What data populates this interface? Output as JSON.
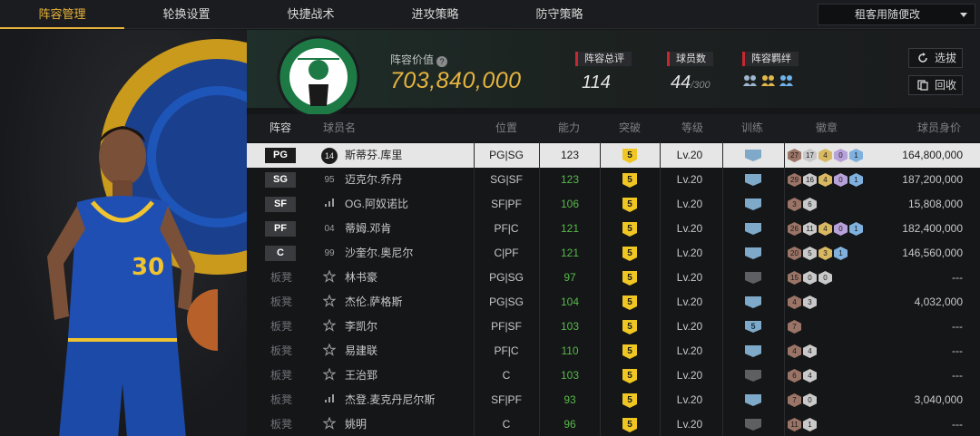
{
  "nav": {
    "tabs": [
      "阵容管理",
      "轮换设置",
      "快捷战术",
      "进攻策略",
      "防守策略"
    ],
    "active_index": 0,
    "dropdown_label": "租客用随便改"
  },
  "header": {
    "value_label": "阵容价值",
    "value": "703,840,000",
    "stats": [
      {
        "label": "阵容总评",
        "value": "114",
        "suffix": ""
      },
      {
        "label": "球员数",
        "value": "44",
        "suffix": "/300"
      },
      {
        "label": "阵容羁绊",
        "value": "",
        "suffix": ""
      }
    ],
    "buttons": {
      "select": "选拔",
      "recycle": "回收"
    },
    "team_logo_text": "BOSTON CELTICS"
  },
  "table": {
    "columns": [
      "阵容",
      "球员名",
      "位置",
      "能力",
      "突破",
      "等级",
      "训练",
      "徽章",
      "球员身价"
    ],
    "rows": [
      {
        "slot": "PG",
        "bench": false,
        "rank": "14",
        "rank_badge": true,
        "name": "斯蒂芬.库里",
        "pos": "PG|SG",
        "ability": "123",
        "breakthrough": "5",
        "level": "Lv.20",
        "training": "",
        "training_grey": false,
        "badges": [
          [
            "27",
            "bronze"
          ],
          [
            "17",
            "silver"
          ],
          [
            "4",
            "gold"
          ],
          [
            "0",
            "purple"
          ],
          [
            "1",
            "blue"
          ]
        ],
        "value": "164,800,000",
        "selected": true
      },
      {
        "slot": "SG",
        "bench": false,
        "rank": "95",
        "rank_badge": false,
        "name": "迈克尔.乔丹",
        "pos": "SG|SF",
        "ability": "123",
        "breakthrough": "5",
        "level": "Lv.20",
        "training": "",
        "training_grey": false,
        "badges": [
          [
            "29",
            "bronze"
          ],
          [
            "16",
            "silver"
          ],
          [
            "4",
            "gold"
          ],
          [
            "0",
            "purple"
          ],
          [
            "1",
            "blue"
          ]
        ],
        "value": "187,200,000",
        "selected": false
      },
      {
        "slot": "SF",
        "bench": false,
        "rank": "",
        "rank_badge": false,
        "name": "OG.阿奴诺比",
        "pos": "SF|PF",
        "ability": "106",
        "breakthrough": "5",
        "level": "Lv.20",
        "training": "",
        "training_grey": false,
        "badges": [
          [
            "3",
            "bronze"
          ],
          [
            "6",
            "silver"
          ]
        ],
        "value": "15,808,000",
        "selected": false
      },
      {
        "slot": "PF",
        "bench": false,
        "rank": "04",
        "rank_badge": false,
        "name": "蒂姆.邓肯",
        "pos": "PF|C",
        "ability": "121",
        "breakthrough": "5",
        "level": "Lv.20",
        "training": "",
        "training_grey": false,
        "badges": [
          [
            "26",
            "bronze"
          ],
          [
            "11",
            "silver"
          ],
          [
            "4",
            "gold"
          ],
          [
            "0",
            "purple"
          ],
          [
            "1",
            "blue"
          ]
        ],
        "value": "182,400,000",
        "selected": false
      },
      {
        "slot": "C",
        "bench": false,
        "rank": "99",
        "rank_badge": false,
        "name": "沙奎尔.奥尼尔",
        "pos": "C|PF",
        "ability": "121",
        "breakthrough": "5",
        "level": "Lv.20",
        "training": "",
        "training_grey": false,
        "badges": [
          [
            "20",
            "bronze"
          ],
          [
            "5",
            "silver"
          ],
          [
            "3",
            "gold"
          ],
          [
            "1",
            "blue"
          ]
        ],
        "value": "146,560,000",
        "selected": false
      },
      {
        "slot": "板凳",
        "bench": true,
        "rank": "",
        "rank_badge": false,
        "name": "林书豪",
        "pos": "PG|SG",
        "ability": "97",
        "breakthrough": "5",
        "level": "Lv.20",
        "training": "",
        "training_grey": true,
        "badges": [
          [
            "15",
            "bronze"
          ],
          [
            "0",
            "silver"
          ],
          [
            "0",
            "silver"
          ]
        ],
        "value": "---",
        "selected": false
      },
      {
        "slot": "板凳",
        "bench": true,
        "rank": "",
        "rank_badge": false,
        "name": "杰伦.萨格斯",
        "pos": "PG|SG",
        "ability": "104",
        "breakthrough": "5",
        "level": "Lv.20",
        "training": "",
        "training_grey": false,
        "badges": [
          [
            "4",
            "bronze"
          ],
          [
            "3",
            "silver"
          ]
        ],
        "value": "4,032,000",
        "selected": false
      },
      {
        "slot": "板凳",
        "bench": true,
        "rank": "",
        "rank_badge": false,
        "name": "李凯尔",
        "pos": "PF|SF",
        "ability": "103",
        "breakthrough": "5",
        "level": "Lv.20",
        "training": "5",
        "training_grey": false,
        "badges": [
          [
            "7",
            "bronze"
          ]
        ],
        "value": "---",
        "selected": false
      },
      {
        "slot": "板凳",
        "bench": true,
        "rank": "",
        "rank_badge": false,
        "name": "易建联",
        "pos": "PF|C",
        "ability": "110",
        "breakthrough": "5",
        "level": "Lv.20",
        "training": "",
        "training_grey": false,
        "badges": [
          [
            "4",
            "bronze"
          ],
          [
            "4",
            "silver"
          ]
        ],
        "value": "---",
        "selected": false
      },
      {
        "slot": "板凳",
        "bench": true,
        "rank": "",
        "rank_badge": false,
        "name": "王治郅",
        "pos": "C",
        "ability": "103",
        "breakthrough": "5",
        "level": "Lv.20",
        "training": "",
        "training_grey": true,
        "badges": [
          [
            "6",
            "bronze"
          ],
          [
            "4",
            "silver"
          ]
        ],
        "value": "---",
        "selected": false
      },
      {
        "slot": "板凳",
        "bench": true,
        "rank": "",
        "rank_badge": false,
        "name": "杰登.麦克丹尼尔斯",
        "pos": "SF|PF",
        "ability": "93",
        "breakthrough": "5",
        "level": "Lv.20",
        "training": "",
        "training_grey": false,
        "badges": [
          [
            "7",
            "bronze"
          ],
          [
            "0",
            "silver"
          ]
        ],
        "value": "3,040,000",
        "selected": false
      },
      {
        "slot": "板凳",
        "bench": true,
        "rank": "",
        "rank_badge": false,
        "name": "姚明",
        "pos": "C",
        "ability": "96",
        "breakthrough": "5",
        "level": "Lv.20",
        "training": "",
        "training_grey": true,
        "badges": [
          [
            "11",
            "bronze"
          ],
          [
            "1",
            "silver"
          ]
        ],
        "value": "---",
        "selected": false
      }
    ]
  },
  "colors": {
    "accent": "#e8b33a",
    "ability_green": "#58b84a",
    "bond_red": "#c7272e"
  }
}
